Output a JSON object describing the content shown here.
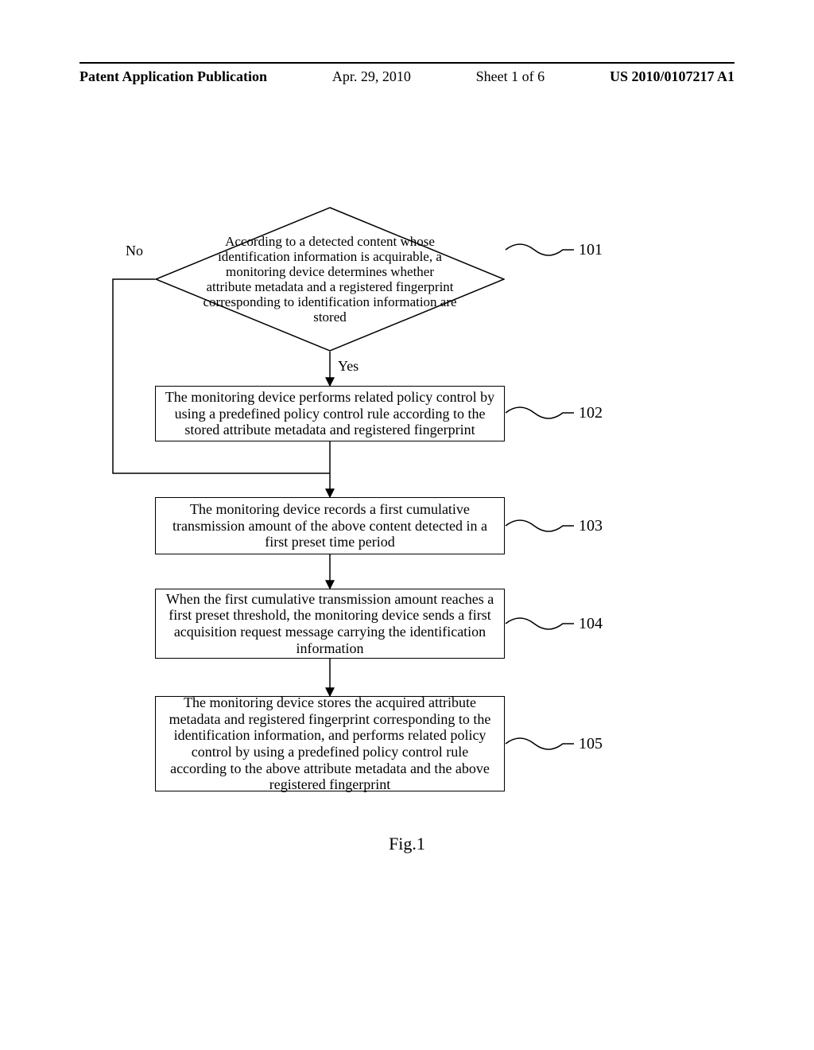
{
  "header": {
    "pub_type": "Patent Application Publication",
    "date": "Apr. 29, 2010",
    "sheet": "Sheet 1 of 6",
    "pub_no": "US 2010/0107217 A1"
  },
  "chart_data": {
    "type": "flowchart",
    "title": "Fig.1",
    "nodes": [
      {
        "id": "101",
        "shape": "decision",
        "text": "According to a detected content whose identification information is acquirable, a monitoring device determines whether attribute metadata and a registered fingerprint corresponding to identification information are stored"
      },
      {
        "id": "102",
        "shape": "process",
        "text": "The monitoring device performs related policy control by using a predefined policy control rule according to the stored attribute metadata and registered fingerprint"
      },
      {
        "id": "103",
        "shape": "process",
        "text": "The monitoring device records a first cumulative transmission amount of the above content detected in a first preset time period"
      },
      {
        "id": "104",
        "shape": "process",
        "text": "When the first cumulative transmission amount reaches a first preset threshold, the monitoring device sends a first acquisition request message carrying the identification information"
      },
      {
        "id": "105",
        "shape": "process",
        "text": "The monitoring device stores the acquired attribute metadata and registered fingerprint corresponding to the identification information, and performs related policy control by using a predefined policy control rule according to the above attribute metadata and the above registered fingerprint"
      }
    ],
    "edges": [
      {
        "from": "101",
        "to": "102",
        "label": "Yes"
      },
      {
        "from": "101",
        "to": "103",
        "label": "No"
      },
      {
        "from": "102",
        "to": "103",
        "label": ""
      },
      {
        "from": "103",
        "to": "104",
        "label": ""
      },
      {
        "from": "104",
        "to": "105",
        "label": ""
      }
    ]
  },
  "labels": {
    "no": "No",
    "yes": "Yes",
    "fig": "Fig.1",
    "s101": "101",
    "s102": "102",
    "s103": "103",
    "s104": "104",
    "s105": "105"
  }
}
